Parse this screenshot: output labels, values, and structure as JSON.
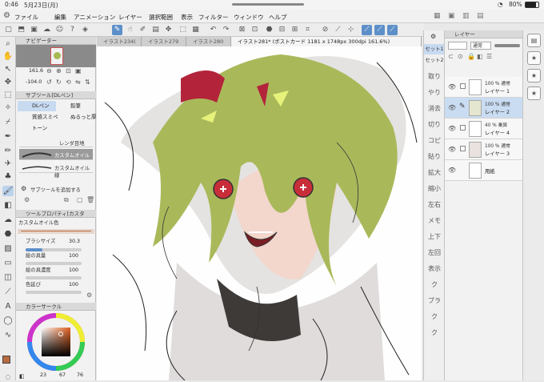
{
  "status": {
    "time": "0:46",
    "date": "5月23日(月)",
    "battery": "80%"
  },
  "menu": [
    "ファイル",
    "編集",
    "アニメーション",
    "レイヤー",
    "選択範囲",
    "表示",
    "フィルター",
    "ウィンドウ",
    "ヘルプ"
  ],
  "navigator": {
    "title": "ナビゲーター",
    "zoom": "161.6",
    "angle": "-104.0"
  },
  "subtool": {
    "title": "サブツール[DLペン]",
    "groups": [
      {
        "left": "DLペン",
        "right": "鉛筆"
      },
      {
        "left": "質感スミペ",
        "right": "ぬるっと厚"
      },
      {
        "left": "トーン",
        "right": ""
      }
    ],
    "brushes": [
      "レンダ目地",
      "カスタムオイル色",
      "カスタムオイル線"
    ],
    "add_label": "サブツールを追加する"
  },
  "toolprop": {
    "title": "ツールプロパティ[カスタ",
    "name": "カスタムオイル色",
    "rows": [
      {
        "label": "ブラシサイズ",
        "value": "30.3"
      },
      {
        "label": "絵の具量",
        "value": "100"
      },
      {
        "label": "絵の具濃度",
        "value": "100"
      },
      {
        "label": "色延び",
        "value": "100"
      }
    ]
  },
  "color": {
    "title": "カラーサークル",
    "h": "23",
    "s": "67",
    "v": "76",
    "main": "#b86a3e"
  },
  "tabs": [
    "イラスト234(",
    "イラスト279",
    "イラスト280",
    "イラスト281* (ポストカード 1181 x 1748px 300dpi 161.6%)"
  ],
  "quickaccess": [
    {
      "label": "セット1",
      "active": true
    },
    {
      "label": "セット2",
      "active": false
    }
  ],
  "quick_items": [
    "取り",
    "やり",
    "消去",
    "切り",
    "コピ",
    "貼り",
    "拡大",
    "縮小",
    "左右",
    "メモ",
    "上下",
    "左回",
    "表示",
    "ク",
    "ブラ",
    "ク",
    "ク"
  ],
  "layers": {
    "title": "レイヤー",
    "blend": "通常",
    "items": [
      {
        "opacity": "100 %",
        "mode": "通常",
        "name": "レイヤー 1",
        "active": false
      },
      {
        "opacity": "100 %",
        "mode": "通常",
        "name": "レイヤー 2",
        "active": true
      },
      {
        "opacity": "40 %",
        "mode": "乗算",
        "name": "レイヤー 4",
        "active": false
      },
      {
        "opacity": "100 %",
        "mode": "通常",
        "name": "レイヤー 3",
        "active": false
      },
      {
        "opacity": "",
        "mode": "",
        "name": "用紙",
        "active": false
      }
    ]
  }
}
